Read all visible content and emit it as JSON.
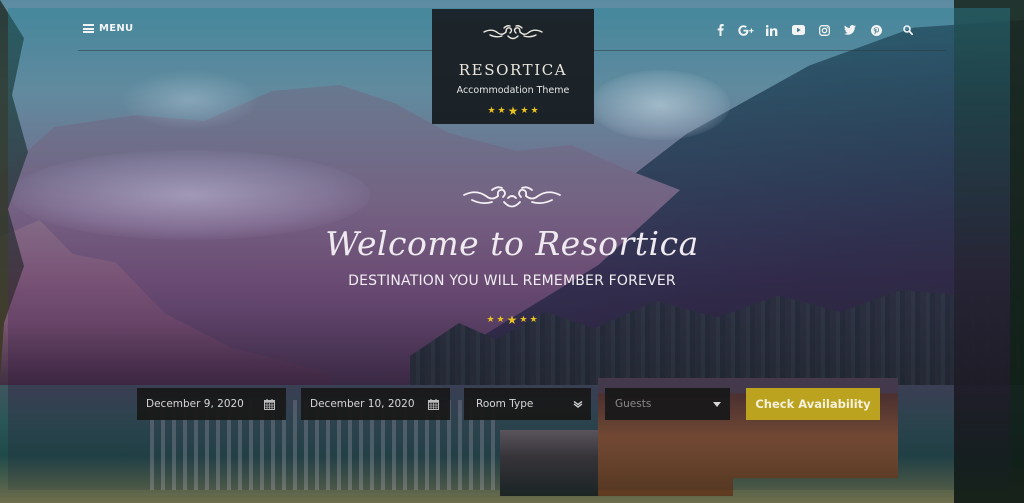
{
  "header": {
    "menu_label": "MENU",
    "menu_icon": "hamburger-icon",
    "social_icons": [
      {
        "name": "facebook-icon",
        "glyph": "f"
      },
      {
        "name": "google-plus-icon",
        "glyph": "G+"
      },
      {
        "name": "linkedin-icon",
        "glyph": "in"
      },
      {
        "name": "youtube-icon",
        "glyph": "▶"
      },
      {
        "name": "instagram-icon",
        "glyph": "◎"
      },
      {
        "name": "twitter-icon",
        "glyph": "🐦"
      },
      {
        "name": "pinterest-icon",
        "glyph": "P"
      },
      {
        "name": "search-icon",
        "glyph": "⌕"
      }
    ]
  },
  "logo": {
    "title": "RESORTICA",
    "subtitle": "Accommodation Theme",
    "stars": 5
  },
  "hero": {
    "title": "Welcome to Resortica",
    "subtitle": "DESTINATION YOU WILL REMEMBER FOREVER",
    "stars": 5
  },
  "booking": {
    "check_in": "December 9, 2020",
    "check_out": "December 10, 2020",
    "room_type": "Room Type",
    "guests_placeholder": "Guests",
    "submit_label": "Check Availability"
  },
  "colors": {
    "accent": "#bba21f",
    "star": "#e8c21d",
    "logo_bg": "#1c252b",
    "field_bg": "#181818"
  }
}
